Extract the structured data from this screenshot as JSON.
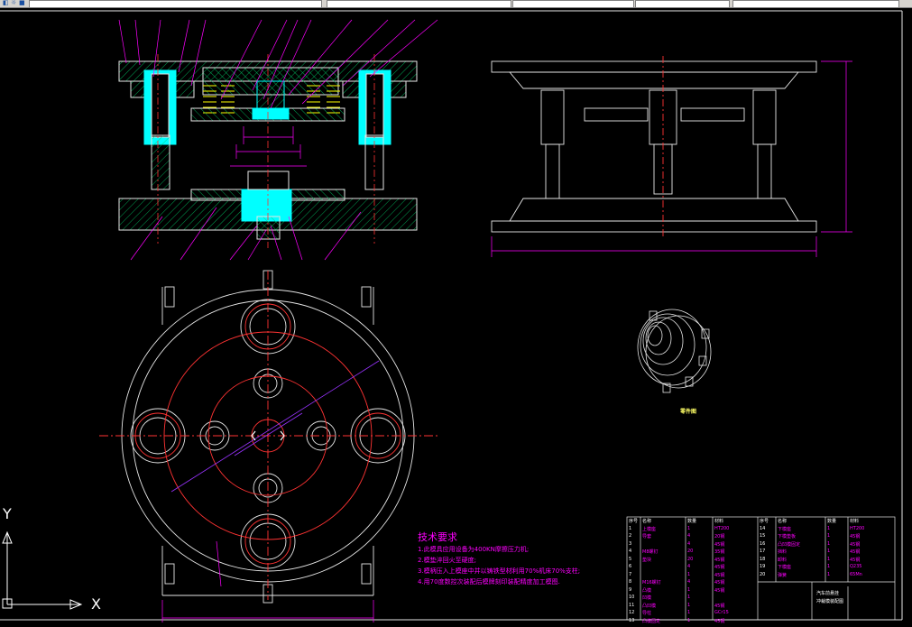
{
  "toolbar": {
    "layer_field": "",
    "style_field_1": "",
    "style_field_2": "",
    "style_field_3": "",
    "right_field": ""
  },
  "ucs": {
    "x_label": "X",
    "y_label": "Y"
  },
  "tech_requirements": {
    "title": "技术要求",
    "items": [
      "1.此模具应用设备为400KN摩擦压力机;",
      "2.模垫淬回火至硬度;",
      "3.模柄压入上模座中并以铸铁型材利用70%机床70%支柱;",
      "4.用70度数控次装配后模牌刻印装配精度加工模图."
    ]
  },
  "iso_caption": "零件图",
  "bom": {
    "headers": [
      "序号",
      "名称",
      "数量",
      "材料",
      "序号",
      "名称",
      "数量",
      "材料"
    ],
    "left_rows": [
      [
        "1",
        "上模座",
        "1",
        "HT200"
      ],
      [
        "2",
        "导套",
        "4",
        "20钢"
      ],
      [
        "3",
        "",
        "4",
        "45钢"
      ],
      [
        "4",
        "M8螺钉",
        "20",
        "35钢"
      ],
      [
        "5",
        "垫块",
        "20",
        "45钢"
      ],
      [
        "6",
        "",
        "4",
        "45钢"
      ],
      [
        "7",
        "",
        "1",
        "45钢"
      ],
      [
        "8",
        "M16螺钉",
        "4",
        "45钢"
      ],
      [
        "9",
        "凸模",
        "1",
        "45钢"
      ],
      [
        "10",
        "凹模",
        "1",
        ""
      ],
      [
        "11",
        "凸凹模",
        "1",
        "45钢"
      ],
      [
        "12",
        "导柱",
        "1",
        "GCr15"
      ],
      [
        "13",
        "凸模固定",
        "1",
        "45钢"
      ]
    ],
    "right_rows": [
      [
        "14",
        "下模座",
        "1",
        "HT200"
      ],
      [
        "15",
        "下模垫板",
        "1",
        "45钢"
      ],
      [
        "16",
        "凸凹模固定",
        "1",
        "45钢"
      ],
      [
        "17",
        "挡料",
        "1",
        "45钢"
      ],
      [
        "18",
        "卸料",
        "1",
        "45钢"
      ],
      [
        "19",
        "下模座",
        "1",
        "Q235"
      ],
      [
        "20",
        "弹簧",
        "1",
        "65Mn"
      ]
    ],
    "title_block": [
      "汽车前悬挂",
      "冲裁模装配图"
    ]
  }
}
